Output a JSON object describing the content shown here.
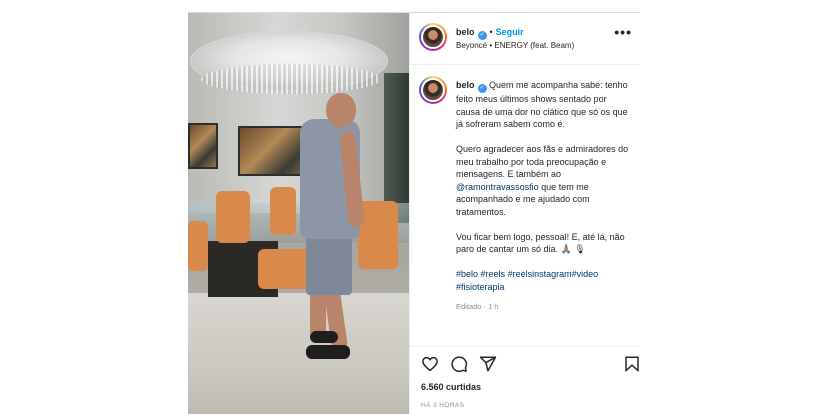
{
  "post_header": {
    "username": "belo",
    "separator": "•",
    "follow_label": "Seguir",
    "audio": "Beyoncé • ENERGY (feat. Beam)",
    "more_label": "•••"
  },
  "caption": {
    "username": "belo",
    "paragraph_1": "Quem me acompanha sabe: tenho feito meus últimos shows sentado por causa de uma dor no ciático que só os que já sofreram sabem como é.",
    "paragraph_2_before": "Quero agradecer aos fãs e admiradores do meu trabalho por toda preocupação e mensagens. E também ao ",
    "mention": "@ramontravassosfio",
    "paragraph_2_after": " que tem me acompanhado e me ajudado com tratamentos.",
    "paragraph_3": "Vou ficar bem logo, pessoal! E, até lá, não paro de cantar um só dia. 🙏🏽 🎙",
    "hashtags": [
      "#belo",
      "#reels",
      "#reelsinstagram",
      "#video",
      "#fisioterapia"
    ],
    "edited": "Editado · 1 h"
  },
  "actions": {
    "like_icon": "heart-icon",
    "comment_icon": "comment-icon",
    "share_icon": "share-icon",
    "save_icon": "bookmark-icon"
  },
  "stats": {
    "likes": "6.560 curtidas",
    "timestamp": "HÁ 3 HORAS"
  },
  "colors": {
    "link": "#0095f6",
    "hashtag": "#00376b",
    "verified": "#3897f0",
    "muted": "#8e8e8e"
  }
}
